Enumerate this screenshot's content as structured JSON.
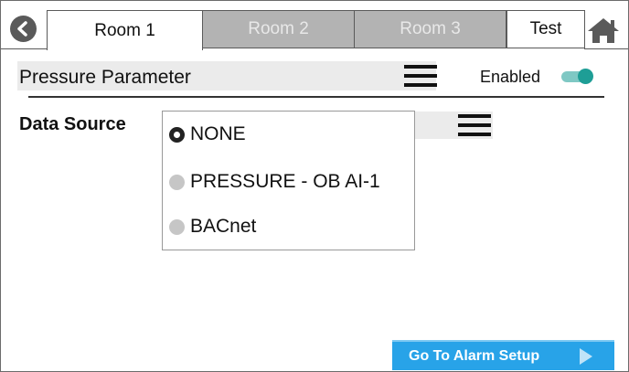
{
  "tabs": {
    "room1": "Room 1",
    "room2": "Room 2",
    "room3": "Room 3",
    "test": "Test"
  },
  "parameter": {
    "title": "Pressure Parameter",
    "enabled_label": "Enabled",
    "enabled": true
  },
  "data_source": {
    "label": "Data Source",
    "options": [
      {
        "label": "NONE",
        "selected": true
      },
      {
        "label": "PRESSURE - OB AI-1",
        "selected": false
      },
      {
        "label": "BACnet",
        "selected": false
      }
    ]
  },
  "footer": {
    "alarm_button": "Go To Alarm Setup"
  },
  "colors": {
    "accent_blue": "#28a3e8",
    "toggle_on": "#1e9e96",
    "inactive_tab": "#b3b3b3"
  },
  "icons": [
    "back-icon",
    "home-icon",
    "menu-icon",
    "chevron-right-icon"
  ]
}
